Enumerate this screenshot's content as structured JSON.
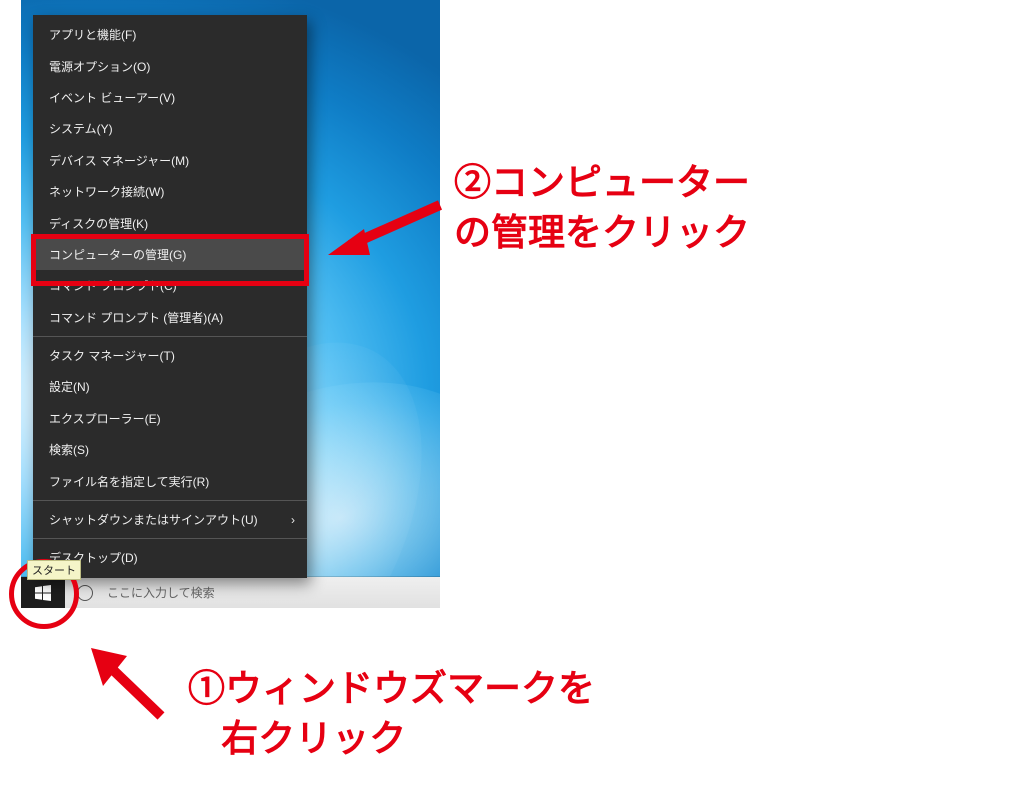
{
  "menu": {
    "items": [
      "アプリと機能(F)",
      "電源オプション(O)",
      "イベント ビューアー(V)",
      "システム(Y)",
      "デバイス マネージャー(M)",
      "ネットワーク接続(W)",
      "ディスクの管理(K)",
      "コンピューターの管理(G)",
      "コマンド プロンプト(C)",
      "コマンド プロンプト (管理者)(A)",
      "タスク マネージャー(T)",
      "設定(N)",
      "エクスプローラー(E)",
      "検索(S)",
      "ファイル名を指定して実行(R)",
      "シャットダウンまたはサインアウト(U)",
      "デスクトップ(D)"
    ],
    "highlighted_index": 7,
    "submenu_index": 15,
    "separators_after": [
      9,
      14,
      15
    ]
  },
  "taskbar": {
    "start_tooltip": "スタート",
    "search_placeholder": "ここに入力して検索"
  },
  "annotations": {
    "step1_line1": "①ウィンドウズマークを",
    "step1_line2": "右クリック",
    "step2_line1": "②コンピューター",
    "step2_line2": "の管理をクリック",
    "highlight_color": "#e60012"
  }
}
